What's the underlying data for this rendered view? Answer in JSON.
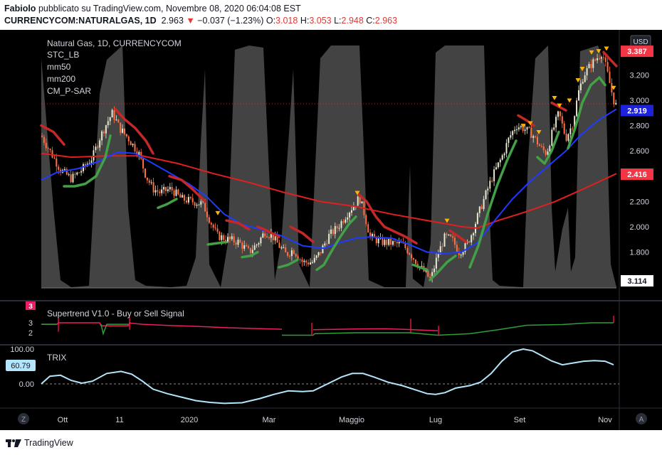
{
  "header": {
    "author": "Fabiolo",
    "published_text": "pubblicato su TradingView.com, Novembre 08, 2020 06:04:08 EST",
    "symbol_line": {
      "symbol": "CURRENCYCOM:NATURALGAS, 1D",
      "last": "2.963",
      "arrow": "▼",
      "change": "−0.037 (−1.23%)",
      "o_label": "O:",
      "o_value": "3.018",
      "h_label": "H:",
      "h_value": "3.053",
      "l_label": "L:",
      "l_value": "2.948",
      "c_label": "C:",
      "c_value": "2.963"
    }
  },
  "legend": {
    "title": "Natural Gas, 1D, CURRENCYCOM",
    "indicators": [
      "STC_LB",
      "mm50",
      "mm200",
      "CM_P-SAR"
    ]
  },
  "price_axis": {
    "currency": "USD",
    "ticks": [
      "3.200",
      "3.000",
      "2.800",
      "2.600",
      "2.400",
      "2.200",
      "2.000",
      "1.800"
    ],
    "badges": [
      {
        "name": "last-price",
        "value": "3.387",
        "color": "#f23645"
      },
      {
        "name": "mm50-price",
        "value": "2.919",
        "color": "#1e22dd"
      },
      {
        "name": "mm200-price",
        "value": "2.416",
        "color": "#f23645"
      },
      {
        "name": "stc-value",
        "value": "3.114",
        "color": "#ffffff"
      }
    ]
  },
  "supertrend": {
    "label": "Supertrend V1.0 - Buy or Sell Signal",
    "ticks": [
      "3",
      "2"
    ],
    "badge": "3"
  },
  "trix": {
    "label": "TRIX",
    "ticks": [
      "100.00",
      "0.00"
    ],
    "badge": "60.79"
  },
  "time_axis": {
    "labels": [
      "Ott",
      "11",
      "2020",
      "Mar",
      "Maggio",
      "Lug",
      "Set",
      "Nov"
    ]
  },
  "footer": {
    "brand": "TradingView"
  },
  "colors": {
    "bull": "#43a047",
    "bear": "#c62828",
    "mm50": "#1e3bff",
    "mm200": "#e02020",
    "stc": "#8a8a8a",
    "trix": "#b3e5fc"
  }
}
